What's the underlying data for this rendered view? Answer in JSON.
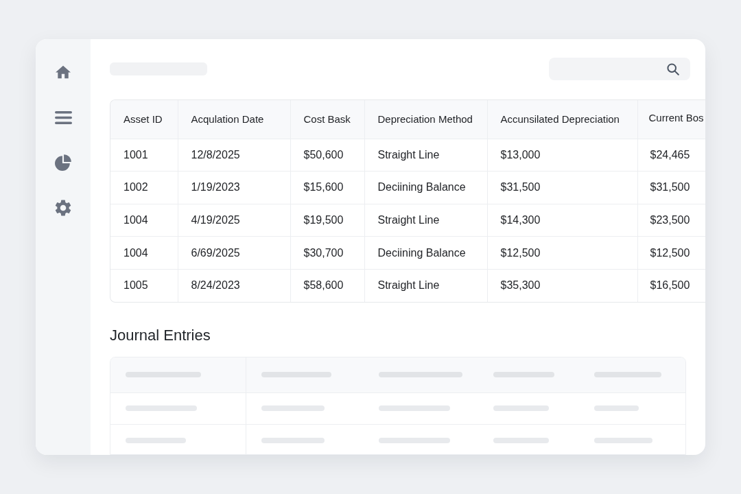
{
  "asset_table": {
    "columns": [
      "Asset ID",
      "Acqulation Date",
      "Cost Bask",
      "Depreciation Method",
      "Accunsilated Depreciation",
      "Current Bos"
    ],
    "rows": [
      [
        "1001",
        "12/8/2025",
        "$50,600",
        "Straight Line",
        "$13,000",
        "$24,465"
      ],
      [
        "1002",
        "1/19/2023",
        "$15,600",
        "Deciining Balance",
        "$31,500",
        "$31,500"
      ],
      [
        "1004",
        "4/19/2025",
        "$19,500",
        "Straight Line",
        "$14,300",
        "$23,500"
      ],
      [
        "1004",
        "6/69/2025",
        "$30,700",
        "Deciining Balance",
        "$12,500",
        "$12,500"
      ],
      [
        "1005",
        "8/24/2023",
        "$58,600",
        "Straight Line",
        "$35,300",
        "$16,500"
      ]
    ]
  },
  "journal_entries": {
    "title": "Journal Entries"
  }
}
